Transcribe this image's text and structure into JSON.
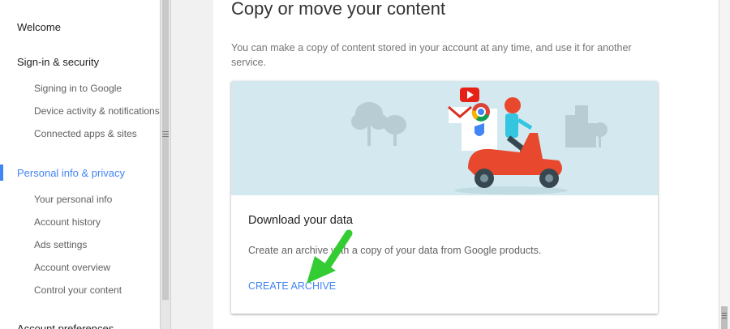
{
  "sidebar": {
    "sections": [
      {
        "label": "Welcome"
      },
      {
        "label": "Sign-in & security",
        "items": [
          "Signing in to Google",
          "Device activity & notifications",
          "Connected apps & sites"
        ]
      },
      {
        "label": "Personal info & privacy",
        "active": true,
        "items": [
          "Your personal info",
          "Account history",
          "Ads settings",
          "Account overview",
          "Control your content"
        ]
      },
      {
        "label": "Account preferences"
      }
    ]
  },
  "main": {
    "title": "Copy or move your content",
    "description": "You can make a copy of content stored in your account at any time, and use it for another service.",
    "card": {
      "title": "Download your data",
      "description": "Create an archive with a copy of your data from Google products.",
      "action": "CREATE ARCHIVE"
    }
  },
  "colors": {
    "accent": "#4285f4",
    "hero_bg": "#d4e8ef",
    "scooter": "#e8482e",
    "arrow": "#33cc33"
  }
}
